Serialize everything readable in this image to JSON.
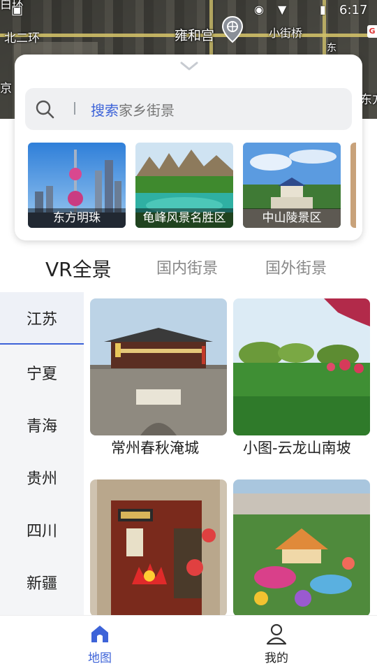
{
  "status_bar": {
    "time": "6:17"
  },
  "map": {
    "labels": {
      "beierhuan": "北二环",
      "yonghegong": "雍和宫",
      "xiaojieqiao": "小街桥",
      "left_edge": "京",
      "right_edge": "东方",
      "top_left": "白环",
      "right_top": "东"
    }
  },
  "search": {
    "placeholder_highlight": "搜索",
    "placeholder_rest": "家乡街景"
  },
  "featured": [
    {
      "name": "东方明珠"
    },
    {
      "name": "龟峰风景名胜区"
    },
    {
      "name": "中山陵景区"
    }
  ],
  "tabs": [
    {
      "label": "VR全景"
    },
    {
      "label": "国内街景"
    },
    {
      "label": "国外街景"
    }
  ],
  "provinces": [
    "江苏",
    "宁夏",
    "青海",
    "贵州",
    "四川",
    "新疆"
  ],
  "panoramas": [
    {
      "title": "常州春秋淹城"
    },
    {
      "title": "小图-云龙山南坡"
    },
    {
      "title": ""
    },
    {
      "title": ""
    }
  ],
  "bottom_nav": {
    "map_label": "地图",
    "mine_label": "我的",
    "accent": "#3d63d8"
  }
}
